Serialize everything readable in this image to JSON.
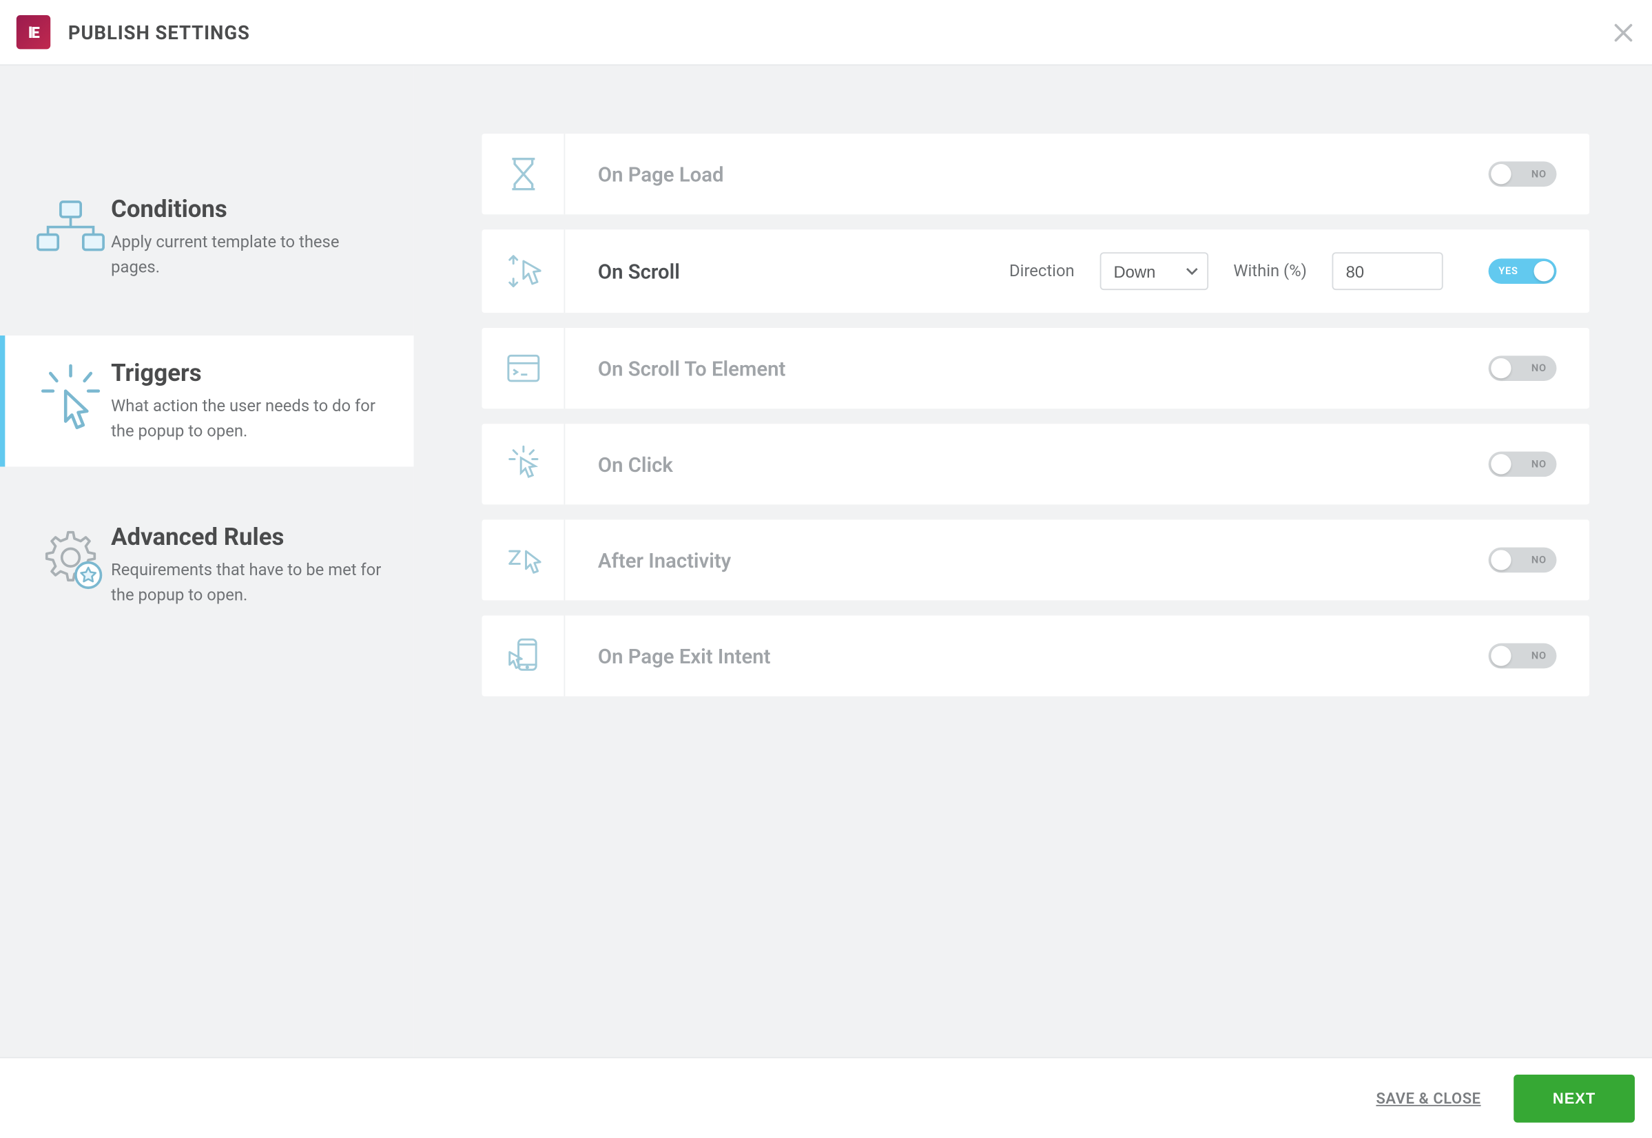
{
  "header": {
    "logo_text": "lE",
    "title": "PUBLISH SETTINGS"
  },
  "sidebar": {
    "items": [
      {
        "title": "Conditions",
        "desc": "Apply current template to these pages."
      },
      {
        "title": "Triggers",
        "desc": "What action the user needs to do for the popup to open."
      },
      {
        "title": "Advanced Rules",
        "desc": "Requirements that have to be met for the popup to open."
      }
    ],
    "active_index": 1
  },
  "triggers": {
    "toggle_on_label": "YES",
    "toggle_off_label": "NO",
    "on_scroll": {
      "direction_label": "Direction",
      "direction_value": "Down",
      "within_label": "Within (%)",
      "within_value": "80"
    },
    "items": [
      {
        "label": "On Page Load",
        "on": false
      },
      {
        "label": "On Scroll",
        "on": true
      },
      {
        "label": "On Scroll To Element",
        "on": false
      },
      {
        "label": "On Click",
        "on": false
      },
      {
        "label": "After Inactivity",
        "on": false
      },
      {
        "label": "On Page Exit Intent",
        "on": false
      }
    ]
  },
  "footer": {
    "save_close": "SAVE & CLOSE",
    "next": "NEXT"
  }
}
